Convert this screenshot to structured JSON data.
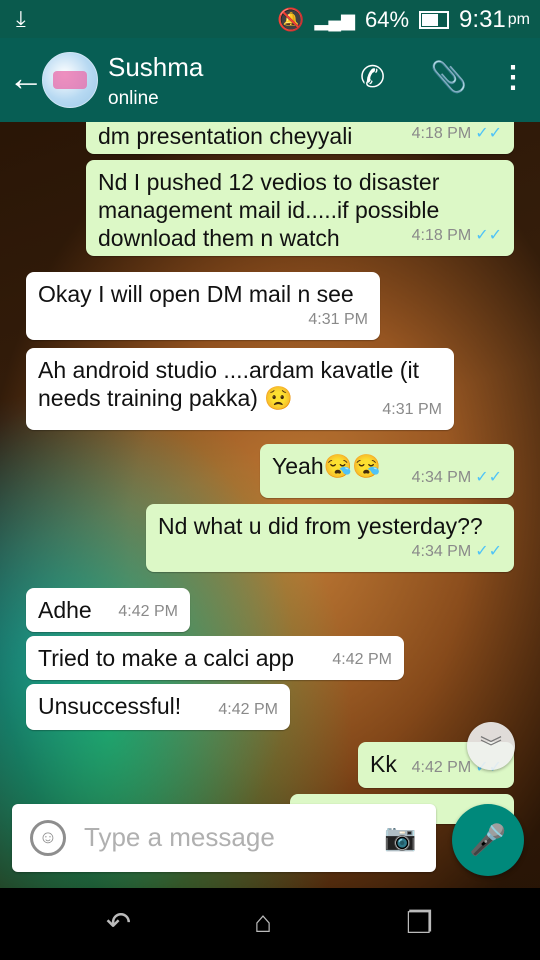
{
  "status_bar": {
    "battery": "64%",
    "time": "9:31",
    "ampm": "pm"
  },
  "header": {
    "contact_name": "Sushma",
    "contact_status": "online"
  },
  "messages": [
    {
      "text": "dm presentation cheyyali",
      "time": "4:18 PM",
      "dir": "out"
    },
    {
      "text": "Nd I pushed 12 vedios to disaster management mail id.....if possible download them n watch",
      "time": "4:18 PM",
      "dir": "out"
    },
    {
      "text": "Okay I will open DM mail n see",
      "time": "4:31 PM",
      "dir": "in"
    },
    {
      "text": "Ah android studio ....ardam kavatle (it needs training pakka) 😟",
      "time": "4:31 PM",
      "dir": "in"
    },
    {
      "text": "Yeah😪😪",
      "time": "4:34 PM",
      "dir": "out"
    },
    {
      "text": "Nd what u did from yesterday??",
      "time": "4:34 PM",
      "dir": "out"
    },
    {
      "text": "Adhe",
      "time": "4:42 PM",
      "dir": "in"
    },
    {
      "text": "Tried to make a calci app",
      "time": "4:42 PM",
      "dir": "in"
    },
    {
      "text": "Unsuccessful!",
      "time": "4:42 PM",
      "dir": "in"
    },
    {
      "text": "Kk",
      "time": "4:42 PM",
      "dir": "out"
    }
  ],
  "composer": {
    "placeholder": "Type a message"
  }
}
